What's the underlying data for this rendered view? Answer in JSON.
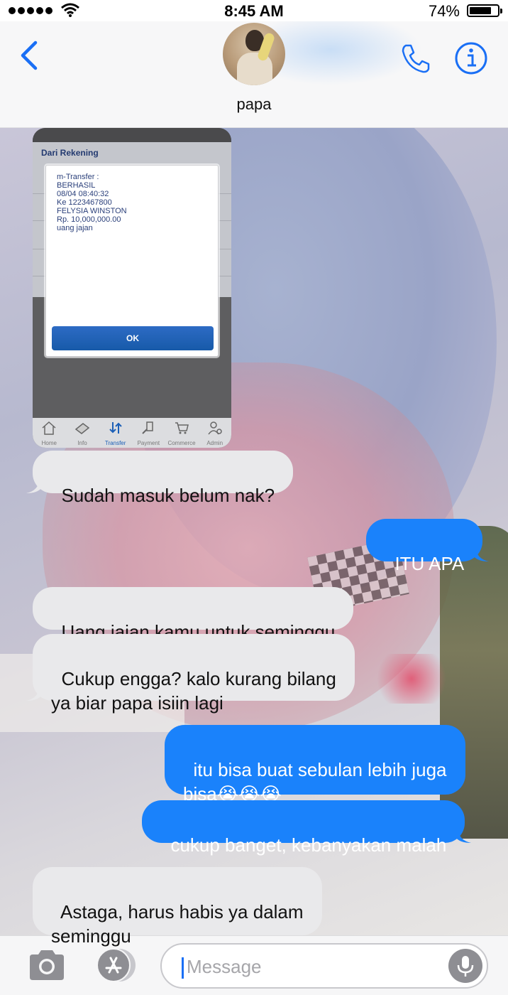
{
  "status_bar": {
    "time": "8:45 AM",
    "battery": "74%",
    "battery_level": 0.74
  },
  "header": {
    "contact_name": "papa"
  },
  "attachment": {
    "panel_label": "Dari Rekening",
    "dialog_lines": "m-Transfer :\nBERHASIL\n08/04 08:40:32\nKe 1223467800\nFELYSIA WINSTON\nRp. 10,000,000.00\nuang jajan",
    "ok_label": "OK",
    "tabs": [
      "Home",
      "Info",
      "Transfer",
      "Payment",
      "Commerce",
      "Admin"
    ],
    "active_tab": "Transfer"
  },
  "messages": [
    {
      "from": "papa",
      "text": "Sudah masuk belum nak?"
    },
    {
      "from": "me",
      "text": "ITU APA"
    },
    {
      "from": "papa",
      "text": "Uang jajan kamu untuk seminggu"
    },
    {
      "from": "papa",
      "text": "Cukup engga? kalo kurang bilang\nya biar papa isiin lagi"
    },
    {
      "from": "me",
      "text": "itu bisa buat sebulan lebih juga\nbisa😭😭😭"
    },
    {
      "from": "me",
      "text": "cukup banget, kebanyakan malah"
    },
    {
      "from": "papa",
      "text": "Astaga, harus habis ya dalam\nseminggu"
    }
  ],
  "input": {
    "placeholder": "Message"
  },
  "colors": {
    "accent": "#1a82fb",
    "incoming_bubble": "#e9e9eb",
    "link_blue": "#1a6ff5"
  }
}
